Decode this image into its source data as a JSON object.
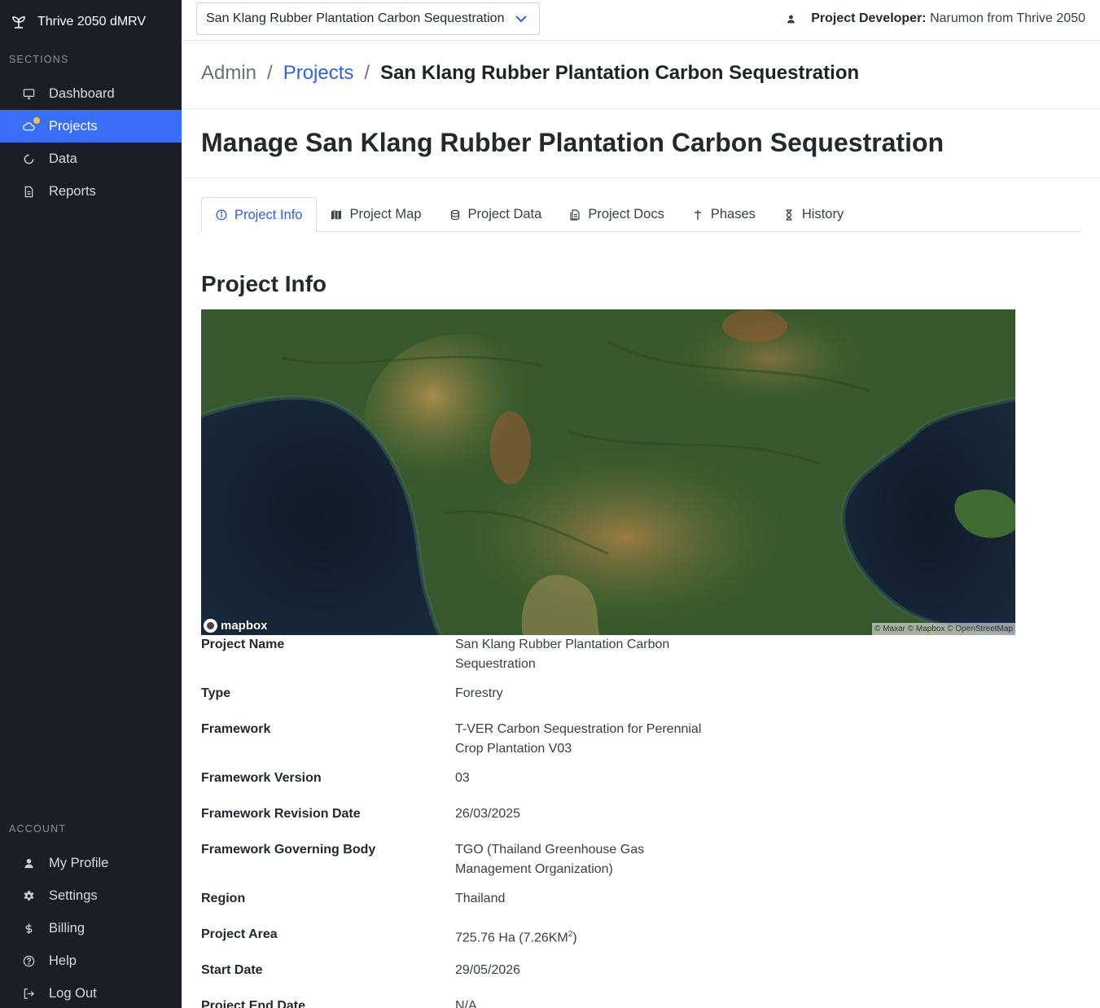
{
  "app": {
    "title": "Thrive 2050 dMRV"
  },
  "sidebar": {
    "sections_label": "SECTIONS",
    "sections": [
      {
        "label": "Dashboard",
        "icon": "monitor-icon"
      },
      {
        "label": "Projects",
        "icon": "cloud-icon",
        "active": true
      },
      {
        "label": "Data",
        "icon": "circle-notch-icon"
      },
      {
        "label": "Reports",
        "icon": "document-icon"
      }
    ],
    "account_label": "ACCOUNT",
    "account": [
      {
        "label": "My Profile",
        "icon": "user-icon"
      },
      {
        "label": "Settings",
        "icon": "gear-icon"
      },
      {
        "label": "Billing",
        "icon": "dollar-icon"
      },
      {
        "label": "Help",
        "icon": "help-icon"
      },
      {
        "label": "Log Out",
        "icon": "logout-icon"
      }
    ]
  },
  "topbar": {
    "selected_project": "San Klang Rubber Plantation Carbon Sequestration",
    "user_role": "Project Developer:",
    "user_name": "Narumon from Thrive 2050"
  },
  "breadcrumb": {
    "root": "Admin",
    "sep": "/",
    "link": "Projects",
    "current": "San Klang Rubber Plantation Carbon Sequestration"
  },
  "page_title": "Manage San Klang Rubber Plantation Carbon Sequestration",
  "tabs": [
    {
      "label": "Project Info",
      "active": true
    },
    {
      "label": "Project Map"
    },
    {
      "label": "Project Data"
    },
    {
      "label": "Project Docs"
    },
    {
      "label": "Phases"
    },
    {
      "label": "History"
    }
  ],
  "section_title": "Project Info",
  "map": {
    "logo": "mapbox",
    "attribution": "© Maxar © Mapbox © OpenStreetMap"
  },
  "info": {
    "project_name": {
      "label": "Project Name",
      "value": "San Klang Rubber Plantation Carbon Sequestration"
    },
    "type": {
      "label": "Type",
      "value": "Forestry"
    },
    "framework": {
      "label": "Framework",
      "value": "T-VER Carbon Sequestration for Perennial Crop Plantation V03"
    },
    "framework_version": {
      "label": "Framework Version",
      "value": "03"
    },
    "framework_revision_date": {
      "label": "Framework Revision Date",
      "value": "26/03/2025"
    },
    "framework_governing_body": {
      "label": "Framework Governing Body",
      "value": "TGO (Thailand Greenhouse Gas Management Organization)"
    },
    "region": {
      "label": "Region",
      "value": "Thailand"
    },
    "project_area": {
      "label": "Project Area",
      "value": "725.76 Ha (7.26KM",
      "sup": "2",
      "suffix": ")"
    },
    "start_date": {
      "label": "Start Date",
      "value": "29/05/2026"
    },
    "end_date": {
      "label": "Project End Date",
      "value": "N/A"
    }
  }
}
